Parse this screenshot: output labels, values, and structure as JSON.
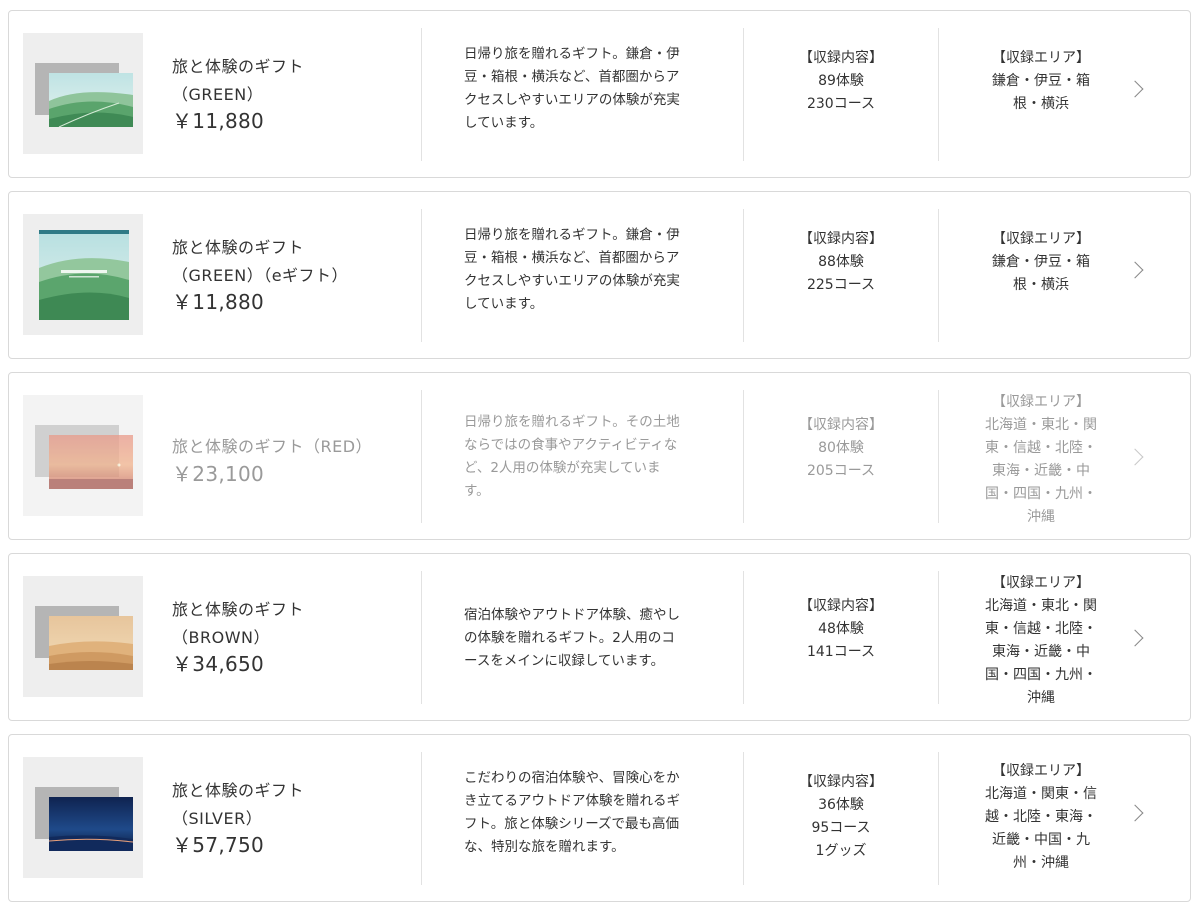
{
  "contents_heading": "【収録内容】",
  "area_heading": "【収録エリア】",
  "items": [
    {
      "title_1": "旅と体験のギフト",
      "title_2": "（GREEN）",
      "price": "￥11,880",
      "desc_lines": [
        "日帰り旅を贈れるギフト。鎌倉・伊",
        "豆・箱根・横浜など、首都圏からア",
        "クセスしやすいエリアの体験が充実",
        "しています。"
      ],
      "experiences": "89体験",
      "courses": "230コース",
      "area_lines": [
        "鎌倉・伊豆・箱",
        "根・横浜"
      ],
      "available": true,
      "thumbnail_theme": "green-hills"
    },
    {
      "title_1": "旅と体験のギフト",
      "title_2": "（GREEN）（eギフト）",
      "price": "￥11,880",
      "desc_lines": [
        "日帰り旅を贈れるギフト。鎌倉・伊",
        "豆・箱根・横浜など、首都圏からア",
        "クセスしやすいエリアの体験が充実",
        "しています。"
      ],
      "experiences": "88体験",
      "courses": "225コース",
      "area_lines": [
        "鎌倉・伊豆・箱",
        "根・横浜"
      ],
      "available": true,
      "thumbnail_theme": "green-hills-egift"
    },
    {
      "title_1": "旅と体験のギフト（RED）",
      "title_2": "",
      "price": "￥23,100",
      "desc_lines": [
        "日帰り旅を贈れるギフト。その土地",
        "ならではの食事やアクティビティな",
        "ど、2人用の体験が充実していま",
        "す。"
      ],
      "experiences": "80体験",
      "courses": "205コース",
      "area_lines": [
        "北海道・東北・関",
        "東・信越・北陸・",
        "東海・近畿・中",
        "国・四国・九州・",
        "沖縄"
      ],
      "available": false,
      "thumbnail_theme": "red-sunset"
    },
    {
      "title_1": "旅と体験のギフト",
      "title_2": "（BROWN）",
      "price": "￥34,650",
      "desc_lines": [
        "宿泊体験やアウトドア体験、癒やし",
        "の体験を贈れるギフト。2人用のコ",
        "ースをメインに収録しています。"
      ],
      "experiences": "48体験",
      "courses": "141コース",
      "area_lines": [
        "北海道・東北・関",
        "東・信越・北陸・",
        "東海・近畿・中",
        "国・四国・九州・",
        "沖縄"
      ],
      "available": true,
      "thumbnail_theme": "brown-desert"
    },
    {
      "title_1": "旅と体験のギフト",
      "title_2": "（SILVER）",
      "price": "￥57,750",
      "desc_lines": [
        "こだわりの宿泊体験や、冒険心をか",
        "き立てるアウトドア体験を贈れるギ",
        "フト。旅と体験シリーズで最も高価",
        "な、特別な旅を贈れます。"
      ],
      "experiences": "36体験",
      "courses": "95コース",
      "goods": "1グッズ",
      "area_lines": [
        "北海道・関東・信",
        "越・北陸・東海・",
        "近畿・中国・九",
        "州・沖縄"
      ],
      "available": true,
      "thumbnail_theme": "silver-night"
    }
  ],
  "colors": {
    "text": "#333333",
    "text_disabled": "#9a9a9a",
    "border": "#d9d9d9",
    "divider": "#e2e2e2",
    "thumb_bg": "#eeeeee"
  },
  "icons": {
    "row_arrow": "chevron-right-icon"
  }
}
